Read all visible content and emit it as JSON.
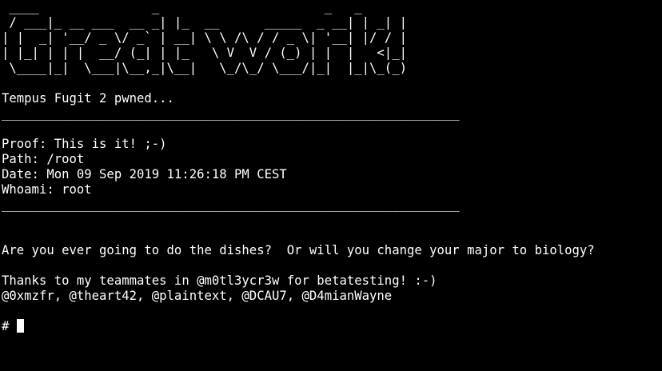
{
  "terminal": {
    "lines": [
      " ____               _                      _   _    ",
      " / ___|_ __ ___  __ _| |_  __      _____  _ __| | _| |",
      "| |  _| '__/ _ \\/ _` | __| \\ \\ /\\ / / _ \\| '__| |/ / |",
      "| |_| | | |  __/ (_| | |_   \\ V  V / (_) | |  |   <|_|",
      " \\____|_|  \\___|\\__,_|\\__|   \\_/\\_/ \\___/|_|  |_|\\_(_)",
      "",
      "Tempus Fugit 2 pwned...",
      "_____________________________________________________________",
      "",
      "Proof: This is it! ;-)",
      "Path: /root",
      "Date: Mon 09 Sep 2019 11:26:18 PM CEST",
      "Whoami: root",
      "_____________________________________________________________",
      "",
      "",
      "Are you ever going to do the dishes?  Or will you change your major to biology?",
      "",
      "Thanks to my teammates in @m0tl3ycr3w for betatesting! :-)",
      "@0xmzfr, @theart42, @plaintext, @DCAU7, @D4mianWayne",
      "",
      "# "
    ]
  },
  "colors": {
    "background": "#000000",
    "foreground": "#ffffff"
  }
}
